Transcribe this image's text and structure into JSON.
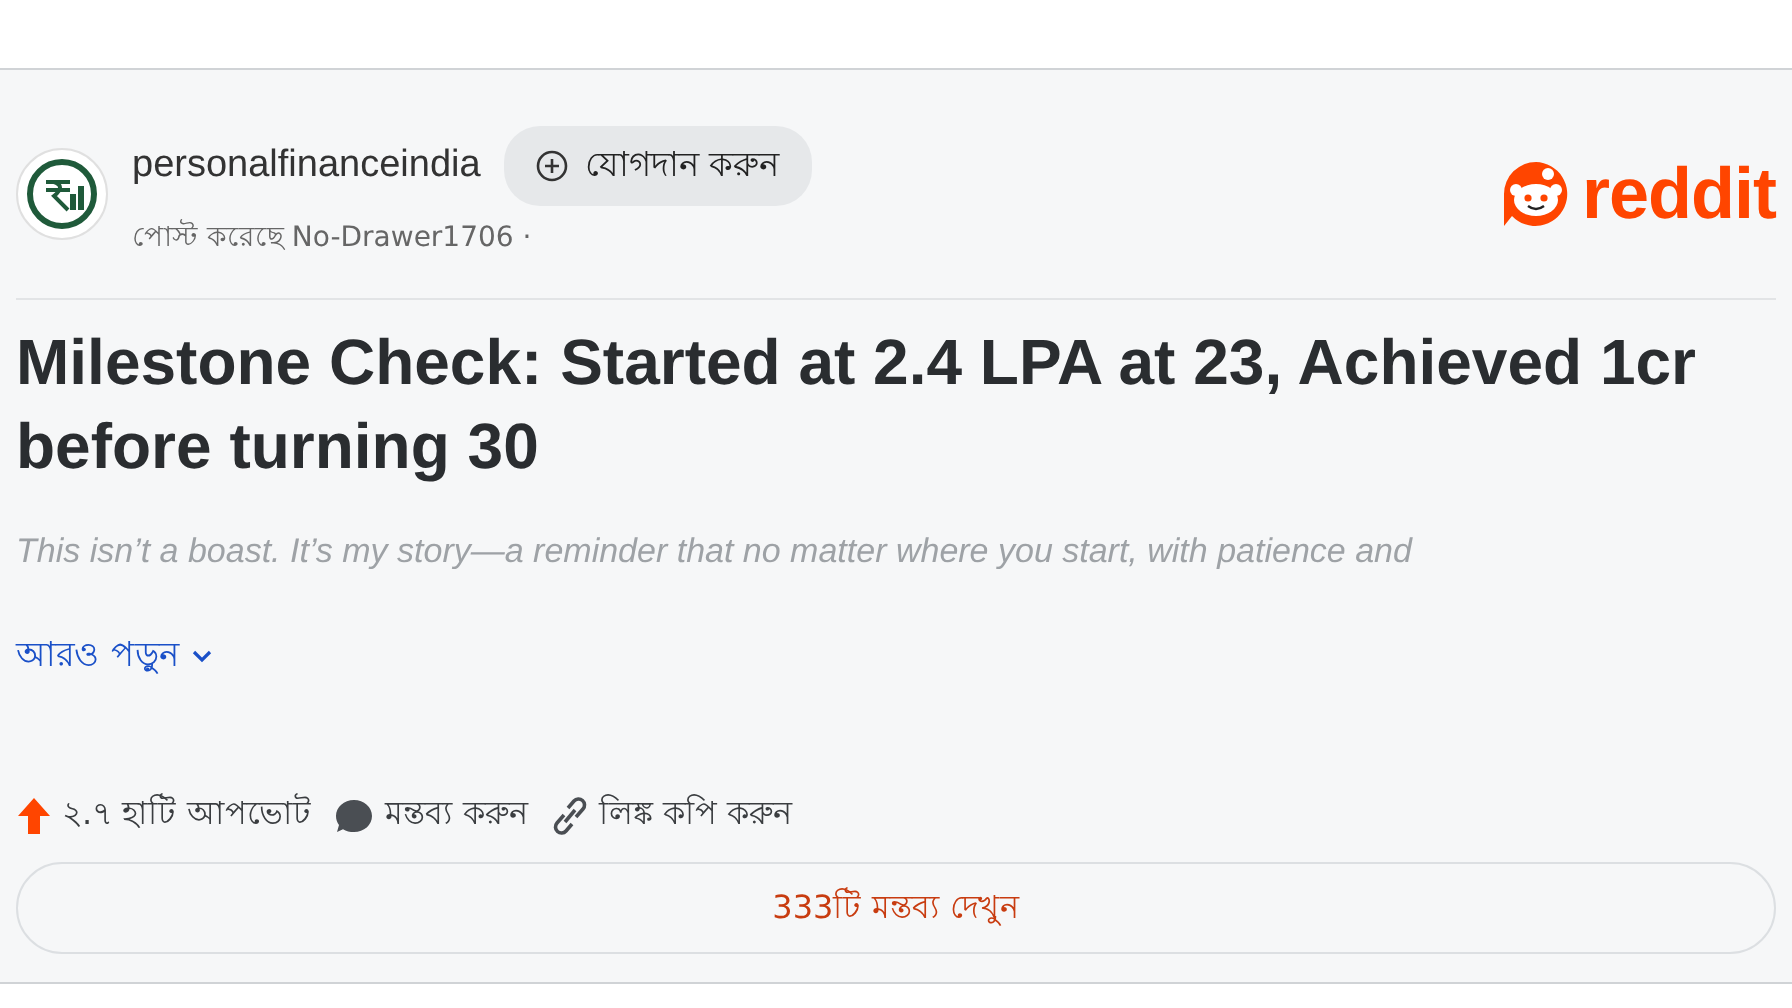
{
  "post": {
    "community": "personalfinanceindia",
    "join_button": "যোগদান করুন",
    "byline": "পোস্ট করেছে No-Drawer1706 ·",
    "brand": "reddit",
    "title": "Milestone Check: Started at 2.4 LPA at 23, Achieved 1cr before turning 30",
    "excerpt": "This isn’t a boast. It’s my story—a reminder that no matter where you start, with patience and",
    "read_more": "আরও পড়ুন",
    "actions": [
      {
        "kind": "upvote",
        "label": "২.৭ হাটি আপভোট"
      },
      {
        "kind": "comment",
        "label": "মন্তব্য করুন"
      },
      {
        "kind": "link",
        "label": "লিঙ্ক কপি করুন"
      }
    ],
    "comments_button": "333টি মন্তব্য দেখুন"
  }
}
